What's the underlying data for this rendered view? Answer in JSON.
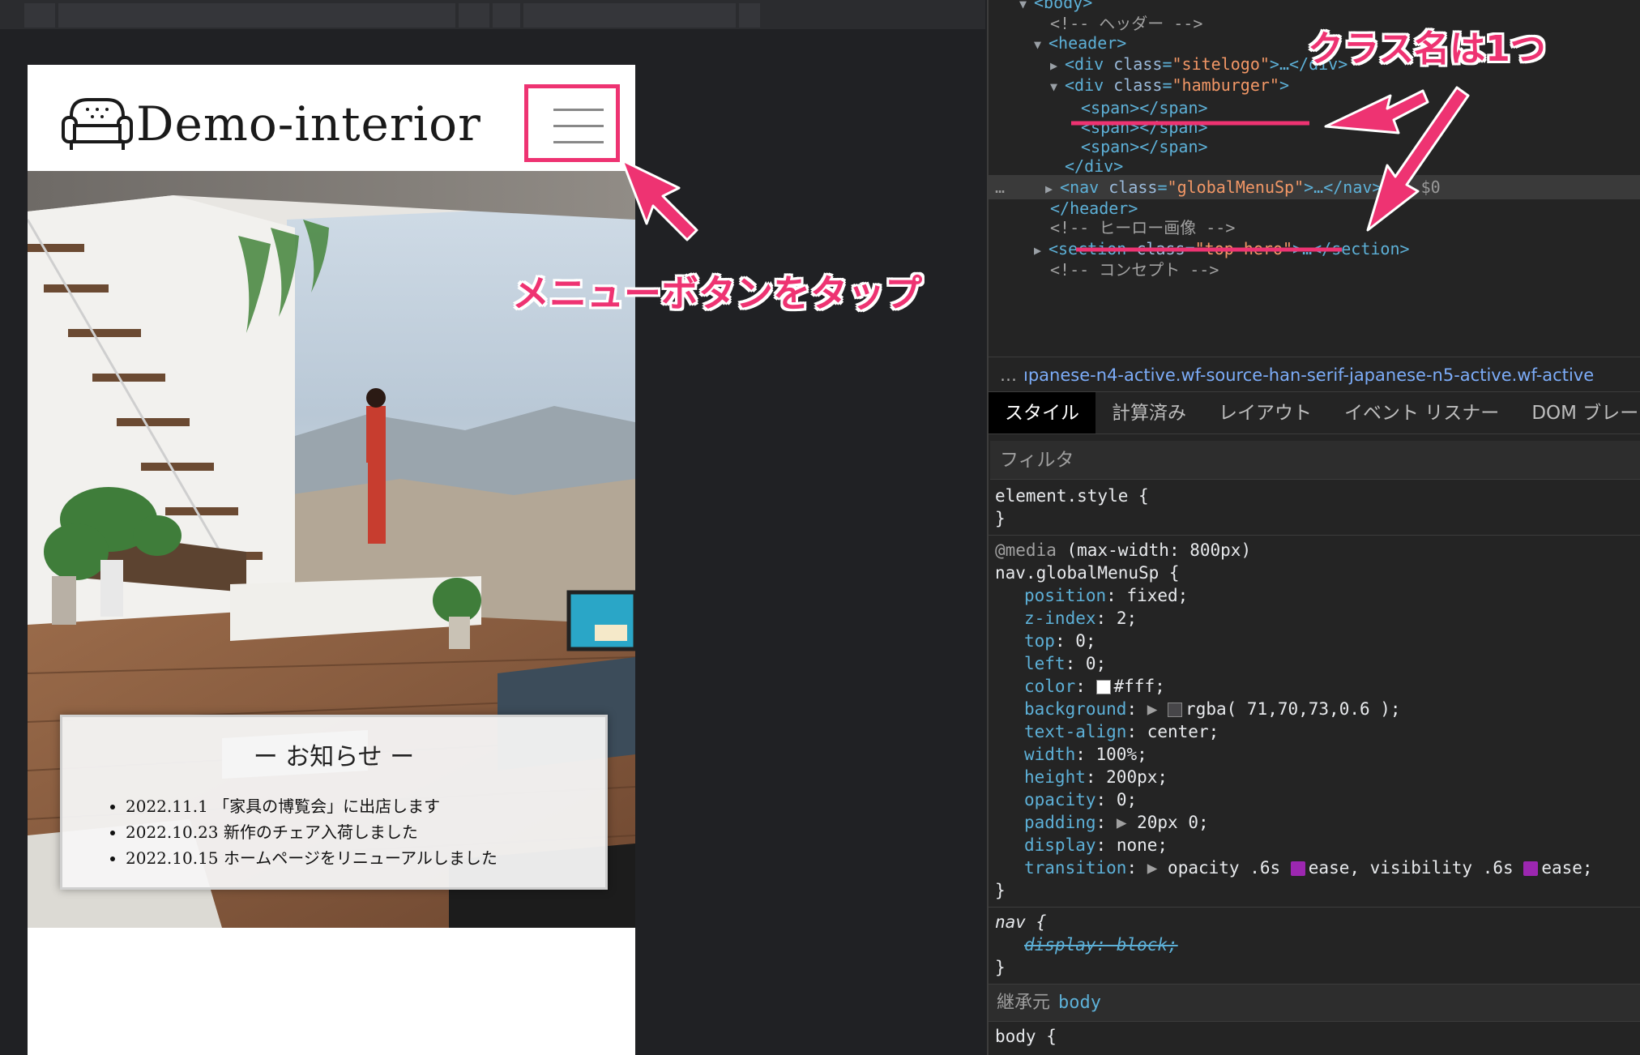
{
  "site": {
    "logo_text": "Demo-interior",
    "notice_title": "ー お知らせ ー",
    "notices": [
      "2022.11.1 「家具の博覧会」に出店します",
      "2022.10.23 新作のチェア入荷しました",
      "2022.10.15 ホームページをリニューアルしました"
    ]
  },
  "annotations": {
    "tap_menu": "メニューボタンをタップ",
    "one_class": "クラス名は1つ",
    "accent_color": "#ee3372"
  },
  "devtools": {
    "tree": {
      "body_open": "<body>",
      "header_comment": "<!-- ヘッダー -->",
      "header_open": "<header>",
      "div_open": "<div",
      "class_attr": "class",
      "sitelogo_val": "\"sitelogo\"",
      "collapsed_div_close": ">…</div>",
      "hamburger_val": "\"hamburger\"",
      "gt": ">",
      "span": "<span></span>",
      "div_close": "</div>",
      "nav_open": "<nav",
      "globalmenu_val": "\"globalMenuSp\"",
      "collapsed_nav_close": ">…</nav>",
      "dollar": "== $0",
      "header_close": "</header>",
      "hero_comment": "<!-- ヒーロー画像 -->",
      "section_open": "<section",
      "tophero_val": "\"top-hero\"",
      "collapsed_section_close": ">…</section>",
      "concept_comment": "<!-- コンセプト -->",
      "row_dots": "…",
      "eq": "="
    },
    "breadcrumb": "ıpanese-n4-active.wf-source-han-serif-japanese-n5-active.wf-active",
    "breadcrumb_dots": "…",
    "tabs": [
      "スタイル",
      "計算済み",
      "レイアウト",
      "イベント リスナー",
      "DOM ブレー"
    ],
    "filter_placeholder": "フィルタ",
    "styles": {
      "element_style": "element.style {",
      "close_brace": "}",
      "media_kw": "@media",
      "media_query": "(max-width: 800px)",
      "selector": "nav.globalMenuSp {",
      "props": [
        {
          "name": "position",
          "value": "fixed;"
        },
        {
          "name": "z-index",
          "value": "2;"
        },
        {
          "name": "top",
          "value": "0;"
        },
        {
          "name": "left",
          "value": "0;"
        },
        {
          "name": "color",
          "value": "#fff;"
        },
        {
          "name": "background",
          "value": "rgba( 71,70,73,0.6 );"
        },
        {
          "name": "text-align",
          "value": "center;"
        },
        {
          "name": "width",
          "value": "100%;"
        },
        {
          "name": "height",
          "value": "200px;"
        },
        {
          "name": "opacity",
          "value": "0;"
        },
        {
          "name": "padding",
          "value": "20px 0;"
        },
        {
          "name": "display",
          "value": "none;"
        }
      ],
      "transition_name": "transition",
      "transition_v1": "opacity .6s",
      "transition_v2": "ease, visibility .6s",
      "transition_v3": "ease;",
      "nav_selector": "nav {",
      "nav_struck": "display: block;",
      "inherit_label": "継承元",
      "inherit_body": "body",
      "body_selector": "body {",
      "swatch_white": "#ffffff",
      "swatch_bg": "#474649"
    }
  }
}
